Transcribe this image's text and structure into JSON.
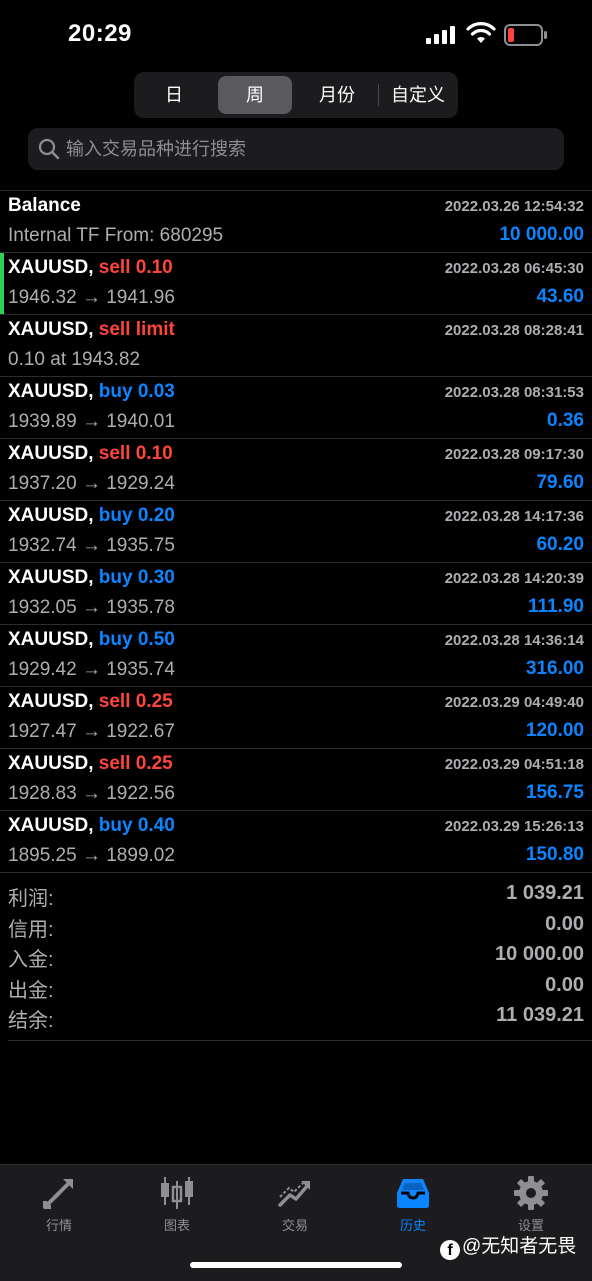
{
  "status_bar": {
    "time": "20:29"
  },
  "period_tabs": [
    {
      "label": "日"
    },
    {
      "label": "周"
    },
    {
      "label": "月份"
    },
    {
      "label": "自定义"
    }
  ],
  "active_period": "周",
  "search": {
    "placeholder": "输入交易品种进行搜索"
  },
  "deals": [
    {
      "symbol": "Balance",
      "side": "",
      "detail": "Internal TF From: 680295",
      "time": "2022.03.26 12:54:32",
      "amount": "10 000.00"
    },
    {
      "symbol": "XAUUSD,",
      "side": "sell 0.10",
      "dir": "sell",
      "detail": "1946.32 → 1941.96",
      "time": "2022.03.28 06:45:30",
      "amount": "43.60"
    },
    {
      "symbol": "XAUUSD,",
      "side": "sell limit",
      "dir": "sell",
      "detail": "0.10 at 1943.82",
      "time": "2022.03.28 08:28:41",
      "amount": ""
    },
    {
      "symbol": "XAUUSD,",
      "side": "buy 0.03",
      "dir": "buy",
      "detail": "1939.89 → 1940.01",
      "time": "2022.03.28 08:31:53",
      "amount": "0.36"
    },
    {
      "symbol": "XAUUSD,",
      "side": "sell 0.10",
      "dir": "sell",
      "detail": "1937.20 → 1929.24",
      "time": "2022.03.28 09:17:30",
      "amount": "79.60"
    },
    {
      "symbol": "XAUUSD,",
      "side": "buy 0.20",
      "dir": "buy",
      "detail": "1932.74 → 1935.75",
      "time": "2022.03.28 14:17:36",
      "amount": "60.20"
    },
    {
      "symbol": "XAUUSD,",
      "side": "buy 0.30",
      "dir": "buy",
      "detail": "1932.05 → 1935.78",
      "time": "2022.03.28 14:20:39",
      "amount": "111.90"
    },
    {
      "symbol": "XAUUSD,",
      "side": "buy 0.50",
      "dir": "buy",
      "detail": "1929.42 → 1935.74",
      "time": "2022.03.28 14:36:14",
      "amount": "316.00"
    },
    {
      "symbol": "XAUUSD,",
      "side": "sell 0.25",
      "dir": "sell",
      "detail": "1927.47 → 1922.67",
      "time": "2022.03.29 04:49:40",
      "amount": "120.00"
    },
    {
      "symbol": "XAUUSD,",
      "side": "sell 0.25",
      "dir": "sell",
      "detail": "1928.83 → 1922.56",
      "time": "2022.03.29 04:51:18",
      "amount": "156.75"
    },
    {
      "symbol": "XAUUSD,",
      "side": "buy 0.40",
      "dir": "buy",
      "detail": "1895.25 → 1899.02",
      "time": "2022.03.29 15:26:13",
      "amount": "150.80"
    }
  ],
  "summary": [
    {
      "label": "利润:",
      "value": "1 039.21"
    },
    {
      "label": "信用:",
      "value": "0.00"
    },
    {
      "label": "入金:",
      "value": "10 000.00"
    },
    {
      "label": "出金:",
      "value": "0.00"
    },
    {
      "label": "结余:",
      "value": "11 039.21"
    }
  ],
  "tab_bar": [
    {
      "label": "行情",
      "icon": "quotes-arrows-icon"
    },
    {
      "label": "图表",
      "icon": "candlestick-chart-icon"
    },
    {
      "label": "交易",
      "icon": "trade-trend-icon"
    },
    {
      "label": "历史",
      "icon": "history-inbox-icon"
    },
    {
      "label": "设置",
      "icon": "gear-icon"
    }
  ],
  "active_tab": "历史",
  "watermark": "@无知者无畏",
  "colors": {
    "sell": "#ff453a",
    "buy": "#0a84ff",
    "accent": "#0a84ff",
    "profit": "#0a84ff",
    "selected_marker": "#30d158"
  }
}
